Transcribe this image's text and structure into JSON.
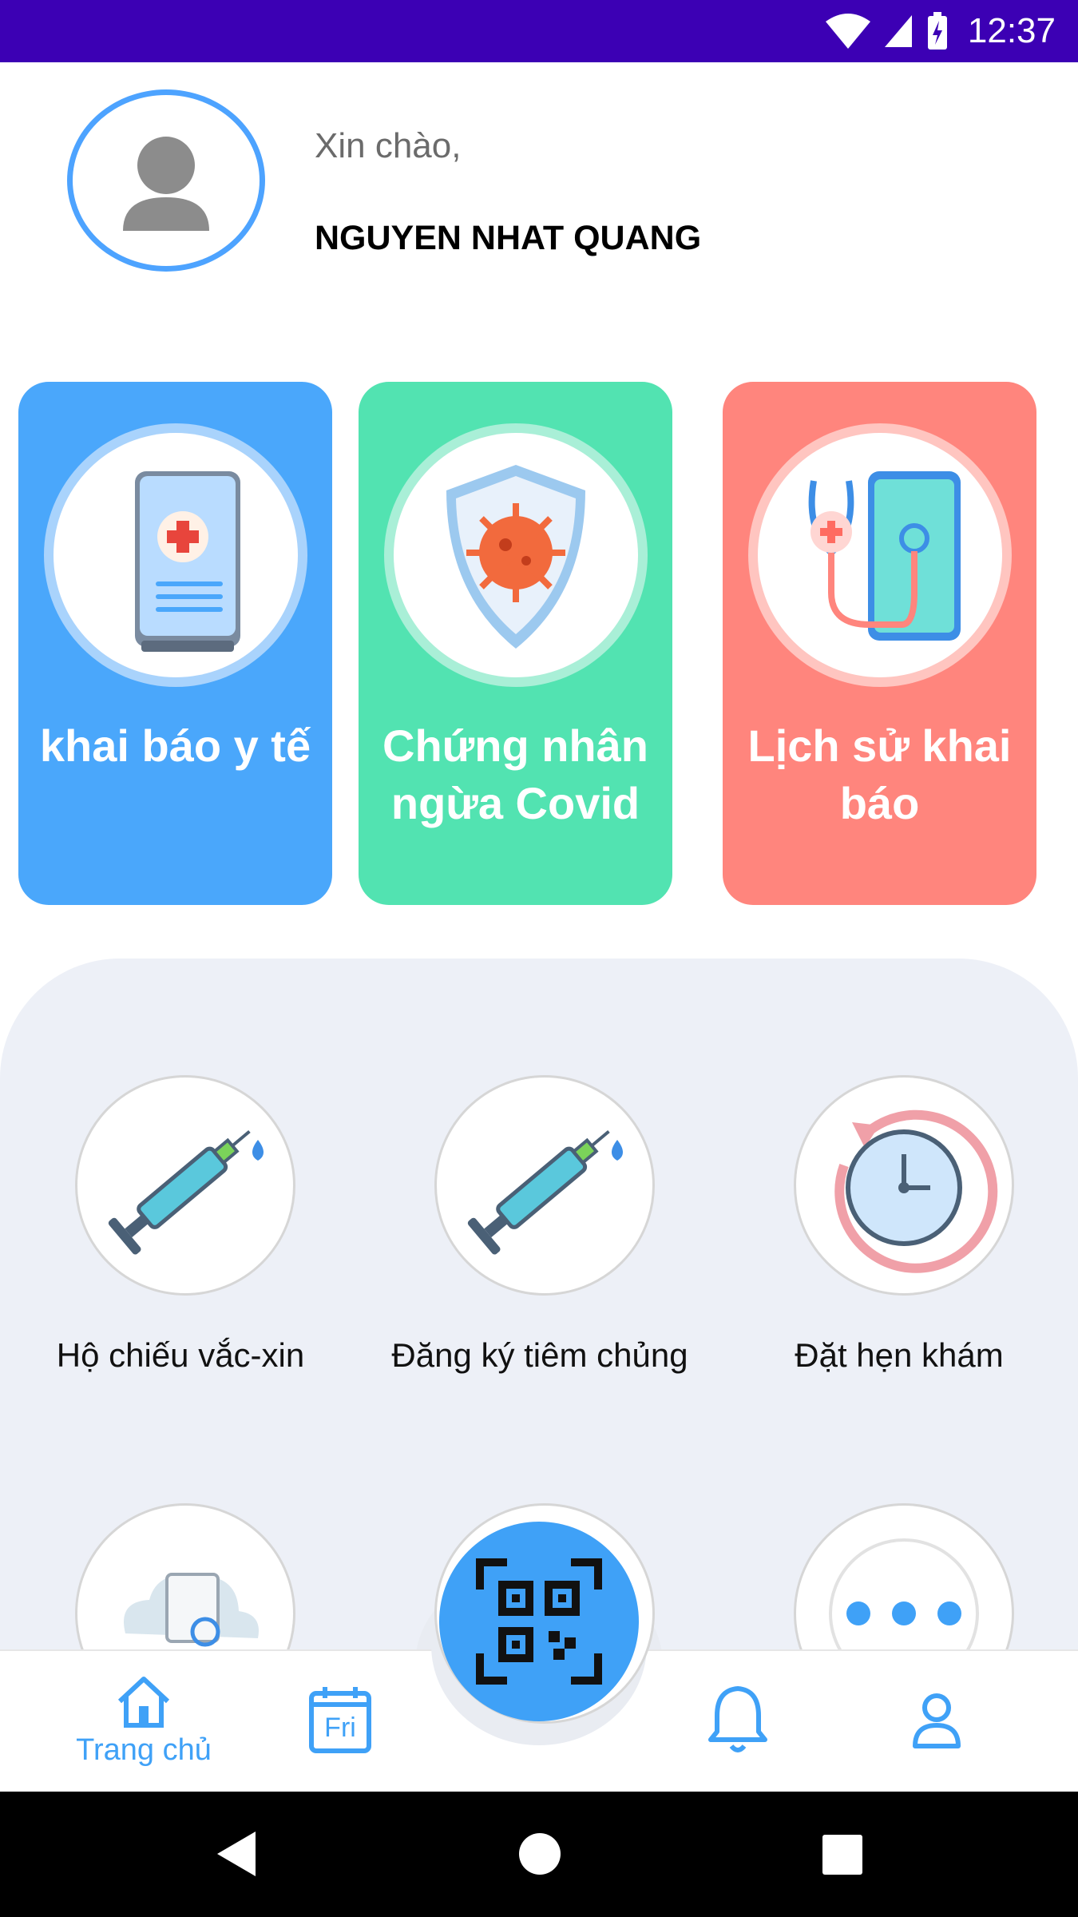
{
  "status_bar": {
    "time": "12:37",
    "background": "#3c00b4"
  },
  "profile": {
    "greeting": "Xin chào,",
    "name": "NGUYEN NHAT QUANG"
  },
  "cards": [
    {
      "label": "khai báo y tế",
      "color": "#4aa7fb",
      "icon": "medical-phone-icon"
    },
    {
      "label": "Chứng nhân ngừa Covid",
      "color": "#52e3b1",
      "icon": "virus-shield-icon"
    },
    {
      "label": "Lịch sử khai báo",
      "color": "#ff857d",
      "icon": "stethoscope-phone-icon"
    }
  ],
  "services": [
    {
      "label": "Hộ chiếu vắc-xin",
      "icon": "syringe-icon"
    },
    {
      "label": "Đăng ký tiêm chủng",
      "icon": "syringe-icon"
    },
    {
      "label": "Đặt hẹn khám",
      "icon": "clock-history-icon"
    },
    {
      "label": "",
      "icon": "document-cloud-icon"
    },
    {
      "label": "",
      "icon": "more-dots-icon"
    }
  ],
  "bottom_nav": {
    "home_label": "Trang chủ",
    "calendar_text": "Fri",
    "accent": "#3fa1f7"
  }
}
